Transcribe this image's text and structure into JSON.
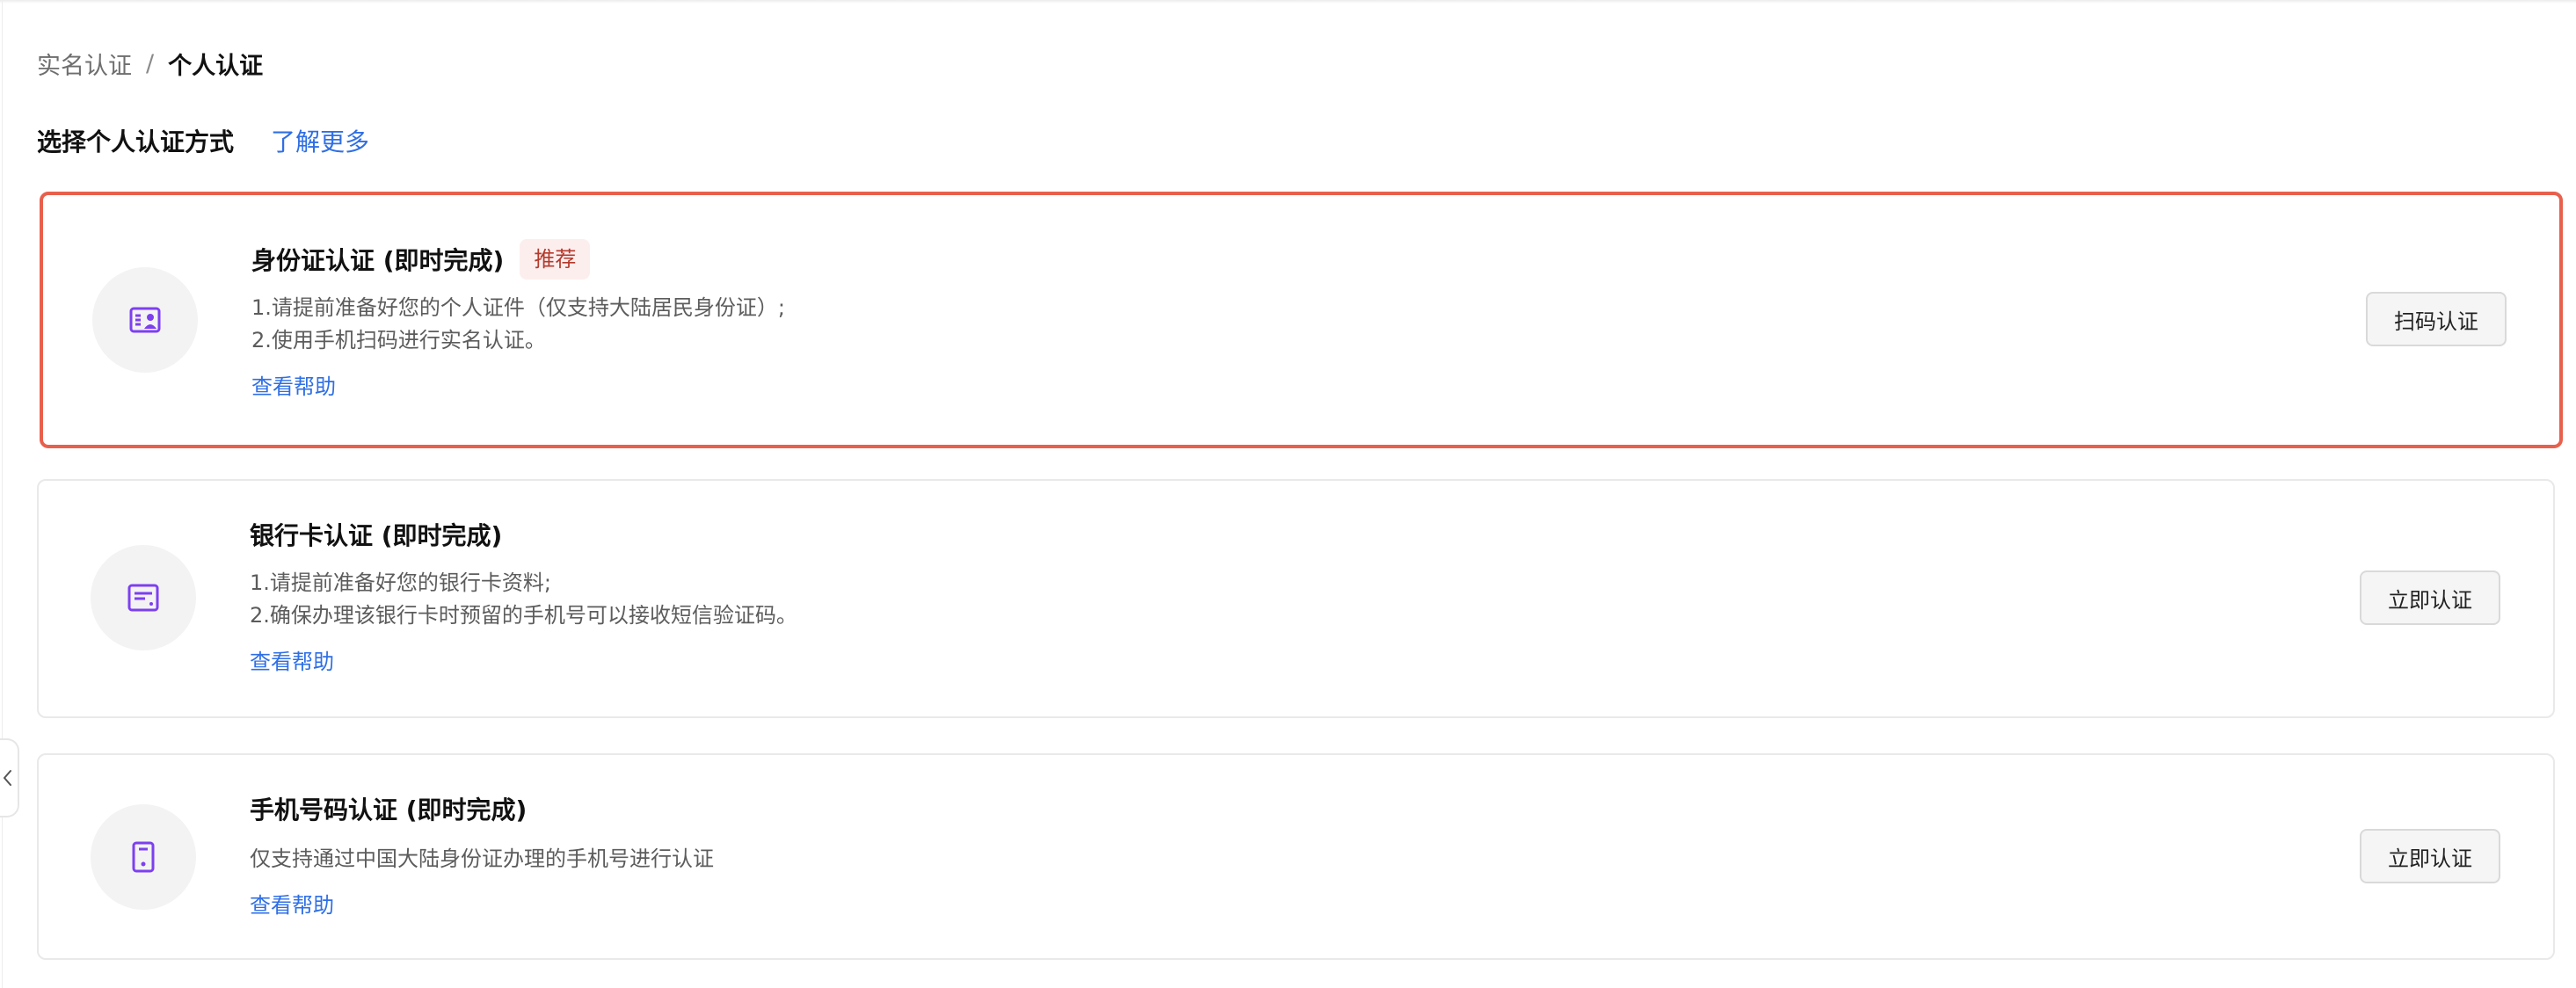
{
  "breadcrumb": {
    "parent": "实名认证",
    "separator": "/",
    "current": "个人认证"
  },
  "section": {
    "title": "选择个人认证方式",
    "learn_more": "了解更多"
  },
  "cards": [
    {
      "icon": "id-card-icon",
      "title": "身份证认证 (即时完成)",
      "badge": "推荐",
      "desc_lines": [
        "1.请提前准备好您的个人证件（仅支持大陆居民身份证）;",
        "2.使用手机扫码进行实名认证。"
      ],
      "help": "查看帮助",
      "button": "扫码认证",
      "selected": true
    },
    {
      "icon": "bank-card-icon",
      "title": "银行卡认证 (即时完成)",
      "desc_lines": [
        "1.请提前准备好您的银行卡资料;",
        "2.确保办理该银行卡时预留的手机号可以接收短信验证码。"
      ],
      "help": "查看帮助",
      "button": "立即认证",
      "selected": false
    },
    {
      "icon": "mobile-phone-icon",
      "title": "手机号码认证 (即时完成)",
      "desc_lines": [
        "仅支持通过中国大陆身份证办理的手机号进行认证"
      ],
      "help": "查看帮助",
      "button": "立即认证",
      "selected": false
    }
  ],
  "colors": {
    "accent_icon": "#7d3ff0",
    "link": "#2f6fe5",
    "highlight_border": "#e8604c",
    "badge_bg": "#fdeeee",
    "badge_text": "#b43a2c"
  }
}
